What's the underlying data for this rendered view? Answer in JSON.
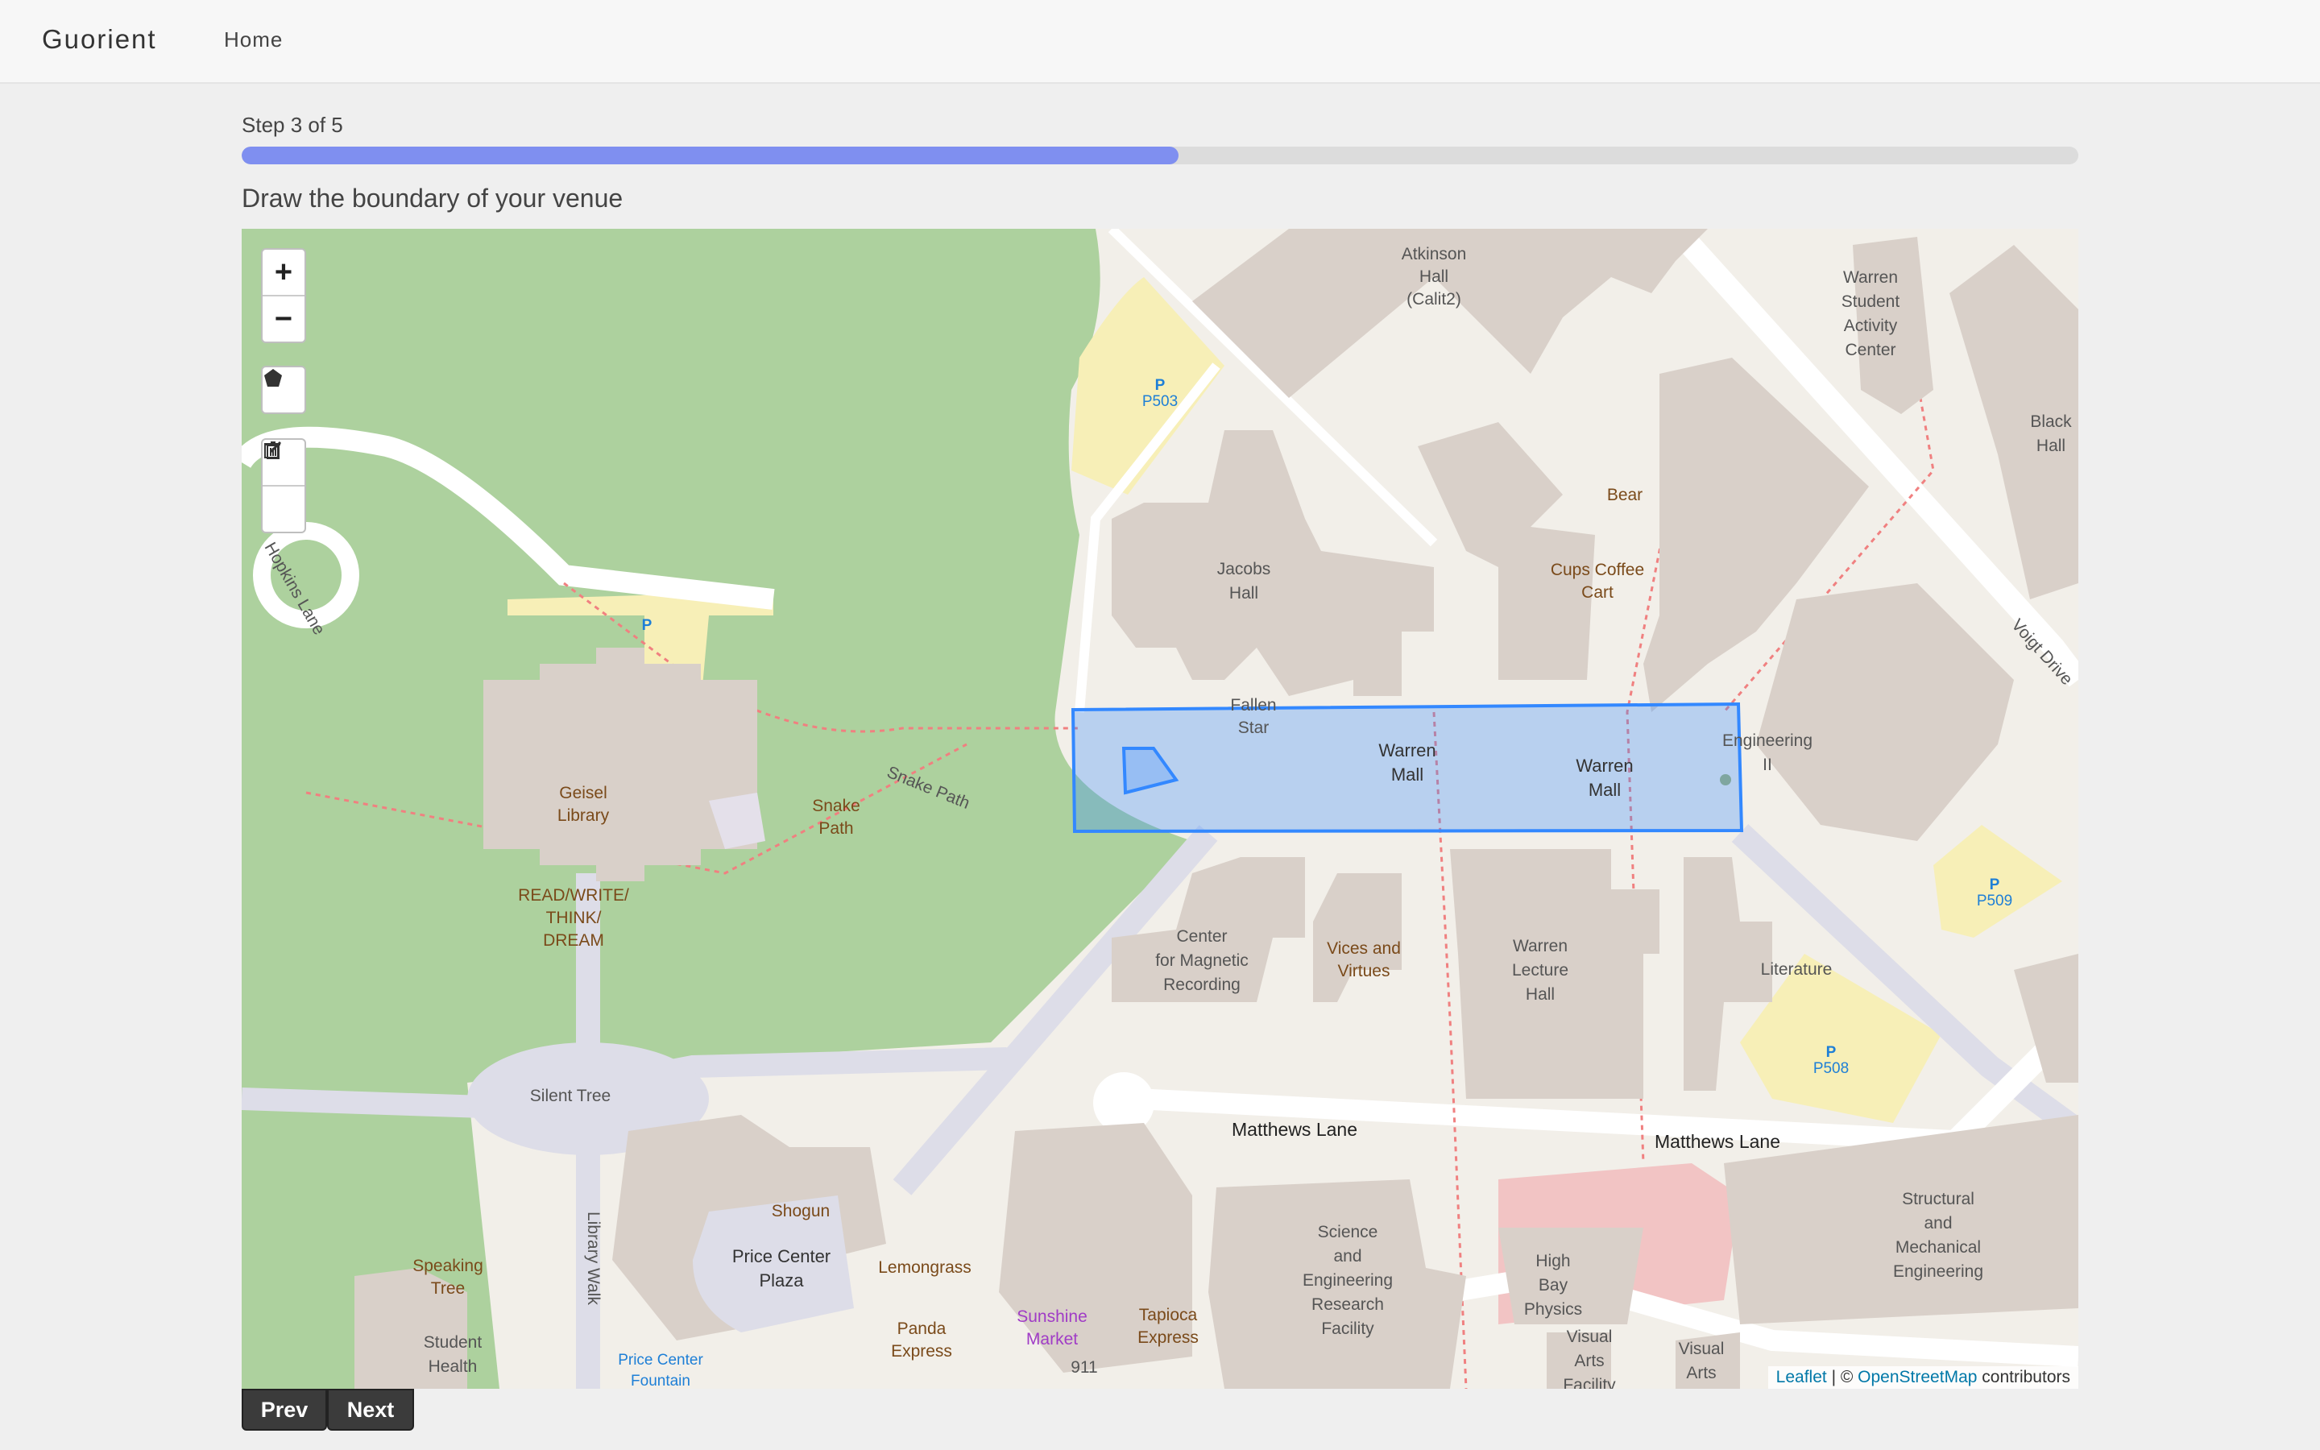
{
  "navbar": {
    "brand": "Guorient",
    "home_link": "Home"
  },
  "wizard": {
    "step_label": "Step 3 of 5",
    "progress_fraction": 0.51,
    "instruction": "Draw the boundary of your venue",
    "prev_label": "Prev",
    "next_label": "Next"
  },
  "map": {
    "controls": {
      "zoom_in": "+",
      "zoom_out": "−"
    },
    "labels": {
      "atkinson": [
        "Atkinson",
        "Hall",
        "(Calit2)"
      ],
      "warren_student": [
        "Warren",
        "Student",
        "Activity",
        "Center"
      ],
      "black_hall": [
        "Black",
        "Hall"
      ],
      "p503": "P503",
      "jacobs": [
        "Jacobs",
        "Hall"
      ],
      "bear": "Bear",
      "cups": [
        "Cups Coffee",
        "Cart"
      ],
      "voigt": "Voigt Drive",
      "hopkins": "Hopkins Lane",
      "fallen_star": [
        "Fallen",
        "Star"
      ],
      "warren_mall_1": [
        "Warren",
        "Mall"
      ],
      "warren_mall_2": [
        "Warren",
        "Mall"
      ],
      "engineering2": [
        "Engineering",
        "II"
      ],
      "geisel": [
        "Geisel",
        "Library"
      ],
      "snake_path_lbl": [
        "Snake",
        "Path"
      ],
      "snake_path_road": "Snake Path",
      "read_write": [
        "READ/WRITE/",
        "THINK/",
        "DREAM"
      ],
      "p509": "P509",
      "center_magnetic": [
        "Center",
        "for Magnetic",
        "Recording"
      ],
      "vices": [
        "Vices and",
        "Virtues"
      ],
      "warren_lecture": [
        "Warren",
        "Lecture",
        "Hall"
      ],
      "literature": "Literature",
      "p508": "P508",
      "silent_tree": "Silent Tree",
      "matthews1": "Matthews Lane",
      "matthews2": "Matthews Lane",
      "shogun": "Shogun",
      "price_center_plaza": [
        "Price Center",
        "Plaza"
      ],
      "lemongrass": "Lemongrass",
      "library_walk": "Library Walk",
      "speaking_tree": [
        "Speaking",
        "Tree"
      ],
      "student_health": [
        "Student",
        "Health"
      ],
      "panda": [
        "Panda",
        "Express"
      ],
      "sunshine": [
        "Sunshine",
        "Market"
      ],
      "addr_911": "911",
      "tapioca": [
        "Tapioca",
        "Express"
      ],
      "science_eng": [
        "Science",
        "and",
        "Engineering",
        "Research",
        "Facility"
      ],
      "high_bay": [
        "High",
        "Bay",
        "Physics"
      ],
      "visual_arts_fac": [
        "Visual",
        "Arts",
        "Facility"
      ],
      "visual_arts": [
        "Visual",
        "Arts"
      ],
      "structural": [
        "Structural",
        "and",
        "Mechanical",
        "Engineering"
      ],
      "price_fountain": [
        "Price Center",
        "Fountain"
      ]
    },
    "attribution": {
      "leaflet": "Leaflet",
      "sep": " | © ",
      "osm": "OpenStreetMap",
      "suffix": " contributors"
    },
    "colors": {
      "wood": "#add19e",
      "building": "#d9d0c9",
      "parking": "#f7efb7",
      "drawn_boundary": "#3388ff"
    }
  }
}
